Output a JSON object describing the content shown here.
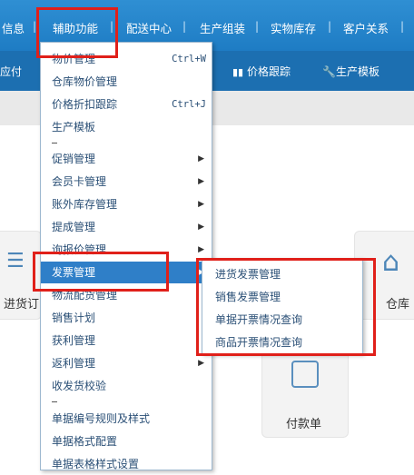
{
  "top_nav": {
    "items": [
      "信息",
      "辅助功能",
      "配送中心",
      "生产组装",
      "实物库存",
      "客户关系"
    ],
    "separator": "|"
  },
  "second_bar": {
    "left_text": "应付",
    "price_track": "价格跟踪",
    "production_template": "生产模板"
  },
  "desktop_tiles": {
    "left_label": "进货订",
    "right_label": "仓库",
    "payment_label": "付款单"
  },
  "menu": {
    "items": [
      {
        "label": "物价管理",
        "shortcut": "Ctrl+W"
      },
      {
        "label": "仓库物价管理"
      },
      {
        "label": "价格折扣跟踪",
        "shortcut": "Ctrl+J"
      },
      {
        "label": "生产模板"
      },
      {
        "label": "促销管理",
        "submenu": true
      },
      {
        "label": "会员卡管理",
        "submenu": true
      },
      {
        "label": "账外库存管理",
        "submenu": true
      },
      {
        "label": "提成管理",
        "submenu": true
      },
      {
        "label": "询报价管理",
        "submenu": true
      },
      {
        "label": "发票管理",
        "submenu": true
      },
      {
        "label": "物流配货管理"
      },
      {
        "label": "销售计划"
      },
      {
        "label": "获利管理"
      },
      {
        "label": "返利管理",
        "submenu": true
      },
      {
        "label": "收发货校验"
      },
      {
        "label": "单据编号规则及样式"
      },
      {
        "label": "单据格式配置"
      },
      {
        "label": "单据表格样式设置"
      }
    ]
  },
  "submenu": {
    "items": [
      "进货发票管理",
      "销售发票管理",
      "单据开票情况查询",
      "商品开票情况查询"
    ]
  },
  "colors": {
    "nav_blue": "#1e7cc4",
    "highlight": "#2f7fc8",
    "red_box": "#e0201a"
  }
}
